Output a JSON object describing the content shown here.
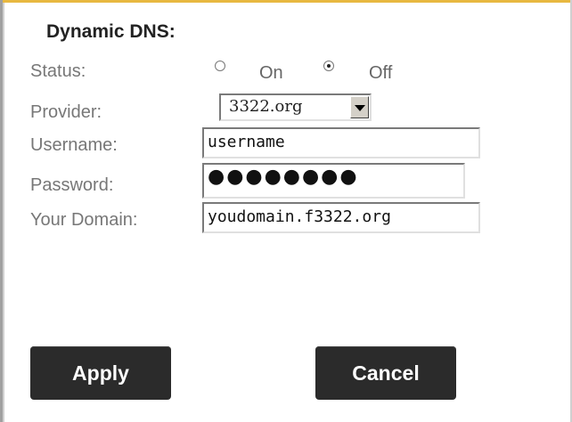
{
  "section": {
    "title": "Dynamic DNS:"
  },
  "fields": {
    "status": {
      "label": "Status:",
      "options": [
        {
          "label": "On",
          "selected": false
        },
        {
          "label": "Off",
          "selected": true
        }
      ]
    },
    "provider": {
      "label": "Provider:",
      "value": "3322.org"
    },
    "username": {
      "label": "Username:",
      "value": "username"
    },
    "password": {
      "label": "Password:",
      "masked_value": "●●●●●●●●"
    },
    "domain": {
      "label": "Your Domain:",
      "value": "youdomain.f3322.org"
    }
  },
  "buttons": {
    "apply": "Apply",
    "cancel": "Cancel"
  },
  "colors": {
    "top_border": "#e8b840",
    "button_bg": "#2b2b2b",
    "label_text": "#777777"
  }
}
